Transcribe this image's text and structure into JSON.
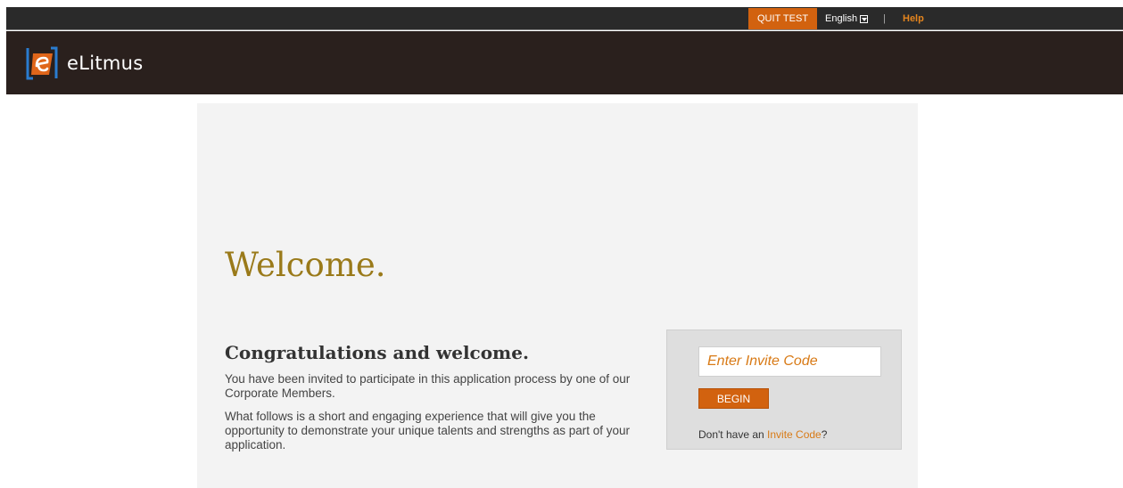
{
  "topbar": {
    "quit_label": "QUIT TEST",
    "language": "English",
    "separator": "|",
    "help_label": "Help"
  },
  "header": {
    "brand": "eLitmus"
  },
  "main": {
    "welcome": "Welcome",
    "welcome_dot": ".",
    "congrats": "Congratulations and welcome.",
    "para1": "You have been invited to participate in this application process by one of our Corporate Members.",
    "para2": "What follows is a short and engaging experience that will give you the opportunity to demonstrate your unique talents and strengths as part of your application."
  },
  "invite": {
    "placeholder": "Enter Invite Code",
    "begin_label": "BEGIN",
    "no_code_prefix": "Don't have an ",
    "no_code_link": "Invite Code",
    "no_code_suffix": "?"
  },
  "colors": {
    "accent": "#d2620f",
    "header_bg": "#2a201d",
    "welcome": "#9a7a1a"
  }
}
